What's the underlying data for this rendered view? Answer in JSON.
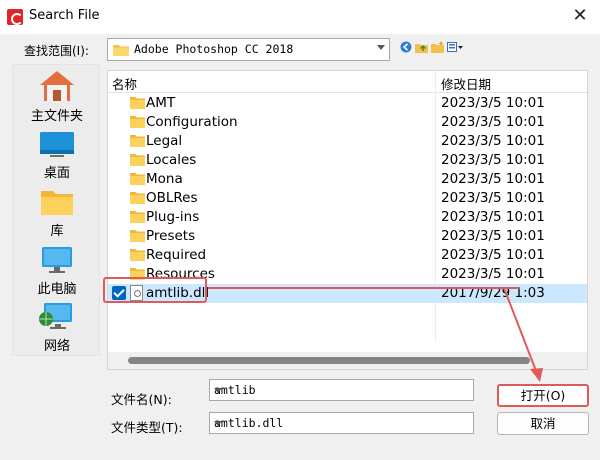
{
  "window": {
    "title": "Search File",
    "close_glyph": "✕"
  },
  "toolbar": {
    "look_in_label": "查找范围(I):",
    "look_in_value": "Adobe Photoshop CC 2018",
    "nav_icons": [
      "back-icon",
      "up-folder-icon",
      "new-folder-icon",
      "view-menu-icon"
    ]
  },
  "places": [
    {
      "label": "主文件夹",
      "icon": "home-icon"
    },
    {
      "label": "桌面",
      "icon": "desktop-icon"
    },
    {
      "label": "库",
      "icon": "library-folder-icon"
    },
    {
      "label": "此电脑",
      "icon": "this-pc-icon"
    },
    {
      "label": "网络",
      "icon": "network-icon"
    }
  ],
  "file_list": {
    "columns": {
      "name": "名称",
      "date": "修改日期"
    },
    "rows": [
      {
        "name": "AMT",
        "date": "2023/3/5 10:01",
        "type": "folder"
      },
      {
        "name": "Configuration",
        "date": "2023/3/5 10:01",
        "type": "folder"
      },
      {
        "name": "Legal",
        "date": "2023/3/5 10:01",
        "type": "folder"
      },
      {
        "name": "Locales",
        "date": "2023/3/5 10:01",
        "type": "folder"
      },
      {
        "name": "Mona",
        "date": "2023/3/5 10:01",
        "type": "folder"
      },
      {
        "name": "OBLRes",
        "date": "2023/3/5 10:01",
        "type": "folder"
      },
      {
        "name": "Plug-ins",
        "date": "2023/3/5 10:01",
        "type": "folder"
      },
      {
        "name": "Presets",
        "date": "2023/3/5 10:01",
        "type": "folder"
      },
      {
        "name": "Required",
        "date": "2023/3/5 10:01",
        "type": "folder"
      },
      {
        "name": "Resources",
        "date": "2023/3/5 10:01",
        "type": "folder"
      },
      {
        "name": "amtlib.dll",
        "date": "2017/9/29 1:03",
        "type": "file",
        "selected": true
      }
    ]
  },
  "filename": {
    "label": "文件名(N):",
    "value": "amtlib"
  },
  "filetype": {
    "label": "文件类型(T):",
    "value": "amtlib.dll"
  },
  "buttons": {
    "open": "打开(O)",
    "cancel": "取消"
  },
  "colors": {
    "selection": "#cce8ff",
    "annotation": "#e15a5a",
    "checkbox": "#0067c0",
    "folder": "#f5c04a"
  }
}
